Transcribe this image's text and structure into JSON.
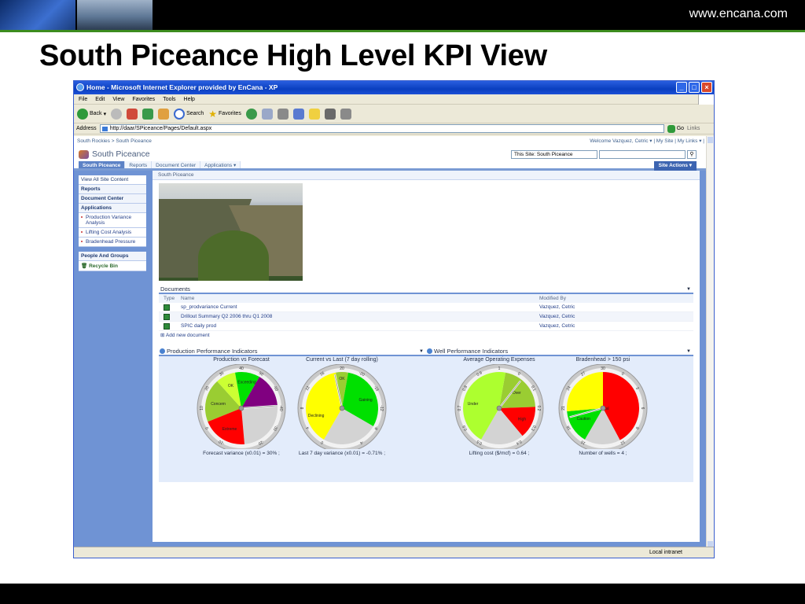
{
  "slide": {
    "url": "www.encana.com",
    "title": "South Piceance High Level KPI View"
  },
  "window": {
    "title": "Home - Microsoft Internet Explorer provided by EnCana - XP"
  },
  "menu": [
    "File",
    "Edit",
    "View",
    "Favorites",
    "Tools",
    "Help"
  ],
  "toolbar": {
    "back": "Back",
    "search": "Search",
    "favorites": "Favorites"
  },
  "address": {
    "label": "Address",
    "url": "http://daar/SPiceance/Pages/Default.aspx",
    "go": "Go",
    "links": "Links"
  },
  "status": {
    "zone": "Local intranet"
  },
  "sp": {
    "breadcrumb_top": "South Rockies > South Piceance",
    "welcome": "Welcome Vazquez, Cetric ▾ | My Site | My Links ▾ |",
    "site_name": "South Piceance",
    "search_scope": "This Site: South Piceance",
    "tabs": [
      "South Piceance",
      "Reports",
      "Document Center",
      "Applications ▾"
    ],
    "site_actions": "Site Actions ▾",
    "leftnav": {
      "view_all": "View All Site Content",
      "reports": "Reports",
      "doc_center": "Document Center",
      "applications": "Applications",
      "apps": [
        "Production Variance Analysis",
        "Lifting Cost Analysis",
        "Bradenhead Pressure"
      ],
      "people": "People And Groups",
      "recycle": "Recycle Bin"
    },
    "page_crumb": "South Piceance",
    "documents": {
      "title": "Documents",
      "col_type": "Type",
      "col_name": "Name",
      "col_modified": "Modified By",
      "rows": [
        {
          "name": "sp_prodvariance Current",
          "modified": "Vazquez, Cetric"
        },
        {
          "name": "Drillout Summary Q2 2006 thru Q1 2008",
          "modified": "Vazquez, Cetric"
        },
        {
          "name": "SPIC daily prod",
          "modified": "Vazquez, Cetric"
        }
      ],
      "add_new": "Add new document"
    },
    "kpi_left": {
      "title": "Production Performance Indicators",
      "gauges": [
        {
          "title": "Production vs Forecast",
          "caption": "Forecast variance (x0.01) = 30% ;",
          "sectors": [
            {
              "label": "Concern",
              "color": "#9acd32"
            },
            {
              "label": "OK",
              "color": "#ccff33"
            },
            {
              "label": "Exceeding",
              "color": "#00e000"
            },
            {
              "label": "",
              "color": "#800080"
            },
            {
              "label": "",
              "color": "#d3d3d3"
            },
            {
              "label": "Extreme",
              "color": "#ff0000"
            }
          ],
          "ticks": [
            "-10",
            "0",
            "10",
            "20",
            "30",
            "40",
            "50",
            "-50",
            "-40",
            "-30",
            "-20"
          ]
        },
        {
          "title": "Current vs Last (7 day rolling)",
          "caption": "Last 7 day variance (x0.01) = -0.71% ;",
          "sectors": [
            {
              "label": "OK",
              "color": "#9acd32"
            },
            {
              "label": "Gaining",
              "color": "#00e000"
            },
            {
              "label": "",
              "color": "#d3d3d3"
            },
            {
              "label": "Declining",
              "color": "#ffff00"
            }
          ],
          "ticks": [
            "0",
            "4",
            "8",
            "12",
            "16",
            "20",
            "-20",
            "-16",
            "-12",
            "-8",
            "-4"
          ]
        }
      ]
    },
    "kpi_right": {
      "title": "Well Performance Indicators",
      "gauges": [
        {
          "title": "Average Operating Expenses",
          "caption": "Lifting cost ($/mcf) = 0.64 ;",
          "sectors": [
            {
              "label": "Over",
              "color": "#9acd32"
            },
            {
              "label": "High",
              "color": "#ff0000"
            },
            {
              "label": "",
              "color": "#d3d3d3"
            },
            {
              "label": "Under",
              "color": "#adff2f"
            }
          ],
          "ticks": [
            "0.5",
            "0.6",
            "0.7",
            "0.8",
            "0.9",
            "1",
            "0",
            "0.1",
            "0.2",
            "0.3",
            "0.4"
          ]
        },
        {
          "title": "Bradenhead > 150 psi",
          "caption": "Number of wells = 4 ;",
          "sectors": [
            {
              "label": "Critical",
              "color": "#ff0000"
            },
            {
              "label": "",
              "color": "#d3d3d3"
            },
            {
              "label": "OK",
              "color": "#00e000"
            },
            {
              "label": "Caution",
              "color": "#ffff00"
            }
          ],
          "ticks": [
            "15",
            "18",
            "21",
            "24",
            "27",
            "30",
            "0",
            "3",
            "6",
            "9",
            "12"
          ]
        }
      ]
    }
  }
}
